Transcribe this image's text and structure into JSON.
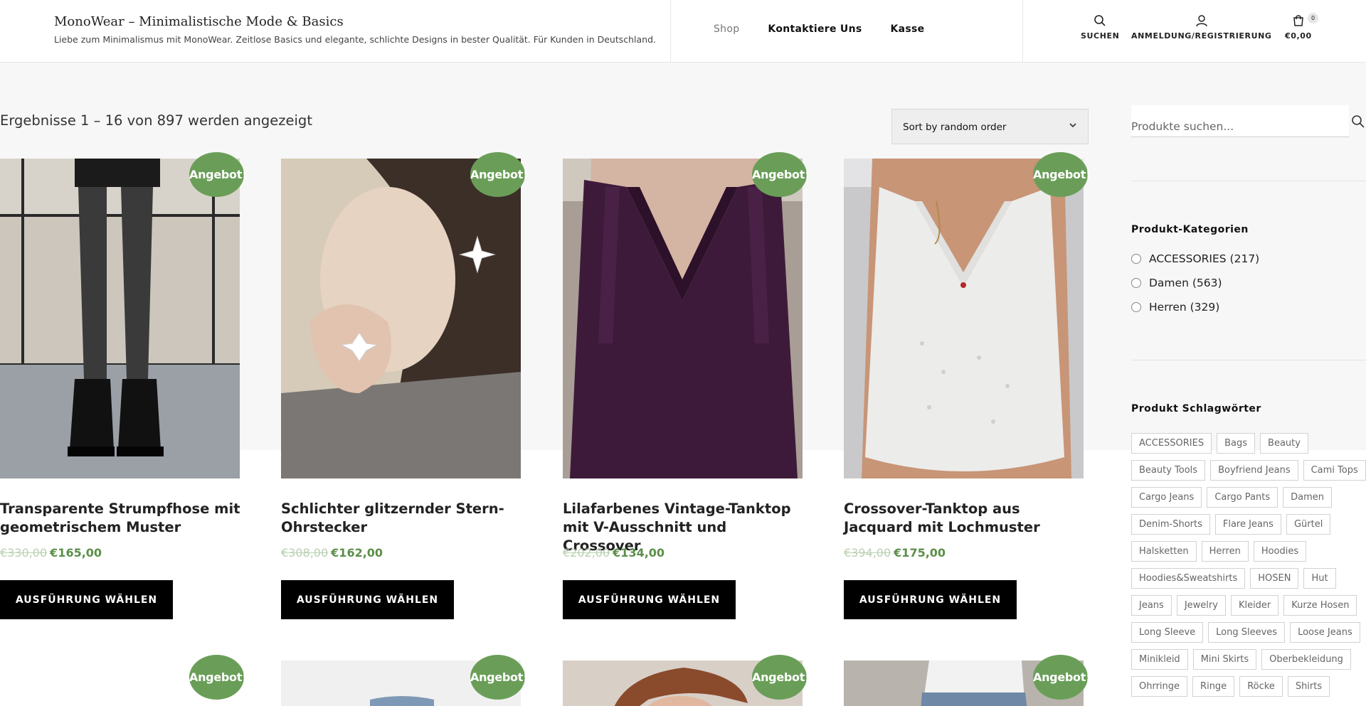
{
  "header": {
    "site_title": "MonoWear – Minimalistische Mode & Basics",
    "tagline": "Liebe zum Minimalismus mit MonoWear. Zeitlose Basics und elegante, schlichte Designs in bester Qualität. Für Kunden in Deutschland.",
    "nav": [
      {
        "label": "Shop",
        "active": true
      },
      {
        "label": "Kontaktiere Uns",
        "active": false
      },
      {
        "label": "Kasse",
        "active": false
      }
    ],
    "search_label": "SUCHEN",
    "account_label": "ANMELDUNG/REGISTRIERUNG",
    "cart_total": "€0,00",
    "cart_count": "0"
  },
  "shop": {
    "result_count": "Ergebnisse 1 – 16 von 897 werden angezeigt",
    "sort_selected": "Sort by random order",
    "sale_badge": "Angebot!",
    "button_label": "AUSFÜHRUNG WÄHLEN",
    "products": [
      {
        "title": "Transparente Strumpfhose mit geometrischem Muster",
        "old_price": "€330,00",
        "price": "€165,00"
      },
      {
        "title": "Schlichter glitzernder Stern-Ohrstecker",
        "old_price": "€308,00",
        "price": "€162,00"
      },
      {
        "title": "Lilafarbenes Vintage-Tanktop mit V-Ausschnitt und Crossover",
        "old_price": "€202,00",
        "price": "€134,00"
      },
      {
        "title": "Crossover-Tanktop aus Jacquard mit Lochmuster",
        "old_price": "€394,00",
        "price": "€175,00"
      }
    ]
  },
  "sidebar": {
    "search_placeholder": "Produkte suchen...",
    "categories_heading": "Produkt-Kategorien",
    "categories": [
      {
        "label": "ACCESSORIES (217)"
      },
      {
        "label": "Damen (563)"
      },
      {
        "label": "Herren (329)"
      }
    ],
    "tags_heading": "Produkt Schlagwörter",
    "tags": [
      "ACCESSORIES",
      "Bags",
      "Beauty",
      "Beauty Tools",
      "Boyfriend Jeans",
      "Cami Tops",
      "Cargo Jeans",
      "Cargo Pants",
      "Damen",
      "Denim-Shorts",
      "Flare Jeans",
      "Gürtel",
      "Halsketten",
      "Herren",
      "Hoodies",
      "Hoodies&Sweatshirts",
      "HOSEN",
      "Hut",
      "Jeans",
      "Jewelry",
      "Kleider",
      "Kurze Hosen",
      "Long Sleeve",
      "Long Sleeves",
      "Loose Jeans",
      "Minikleid",
      "Mini Skirts",
      "Oberbekleidung",
      "Ohrringe",
      "Ringe",
      "Röcke",
      "Shirts"
    ]
  },
  "colors": {
    "sale_green": "#6a9e58",
    "price_green": "#5b8f49",
    "button_black": "#000000"
  },
  "icons": [
    "search-icon",
    "user-icon",
    "cart-icon",
    "chevron-down-icon"
  ]
}
